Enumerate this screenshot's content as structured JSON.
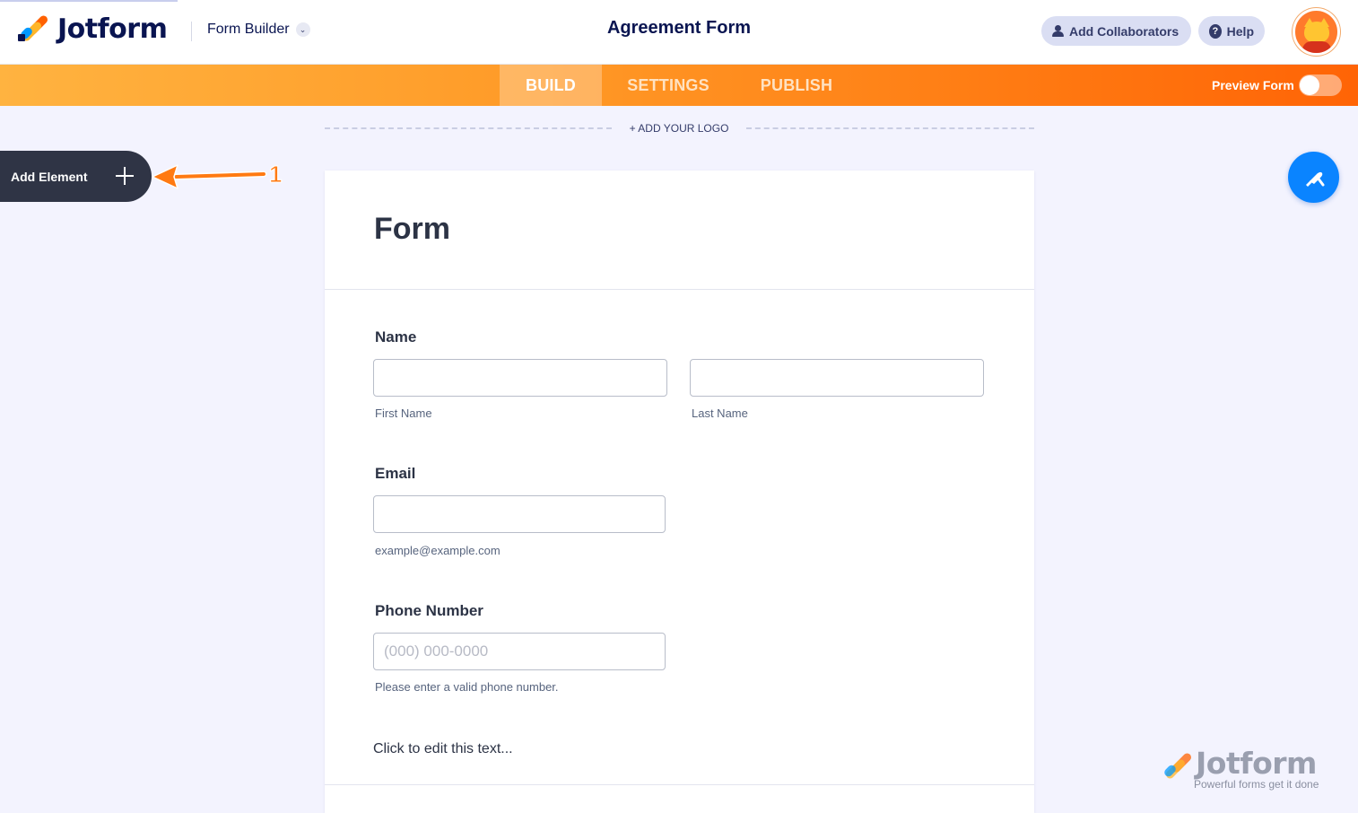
{
  "header": {
    "brand": "Jotform",
    "builder_switch": "Form Builder",
    "form_title": "Agreement Form",
    "add_collaborators": "Add Collaborators",
    "help": "Help"
  },
  "nav": {
    "tabs": [
      {
        "label": "BUILD",
        "active": true
      },
      {
        "label": "SETTINGS",
        "active": false
      },
      {
        "label": "PUBLISH",
        "active": false
      }
    ],
    "preview_label": "Preview Form",
    "preview_enabled": false
  },
  "canvas": {
    "add_logo": "+ ADD YOUR LOGO",
    "add_element": "Add Element",
    "annotation_number": "1"
  },
  "form": {
    "heading": "Form",
    "name": {
      "label": "Name",
      "first_sublabel": "First Name",
      "last_sublabel": "Last Name",
      "first_value": "",
      "last_value": ""
    },
    "email": {
      "label": "Email",
      "sublabel": "example@example.com",
      "value": ""
    },
    "phone": {
      "label": "Phone Number",
      "placeholder": "(000) 000-0000",
      "sublabel": "Please enter a valid phone number."
    },
    "text_block": "Click to edit this text..."
  },
  "watermark": {
    "name": "Jotform",
    "tagline": "Powerful forms get it done"
  },
  "colors": {
    "brand_navy": "#0a1551",
    "nav_orange_start": "#ffb340",
    "nav_orange_end": "#ff6406",
    "designer_blue": "#0a84ff",
    "annotation_orange": "#ff7a12"
  }
}
